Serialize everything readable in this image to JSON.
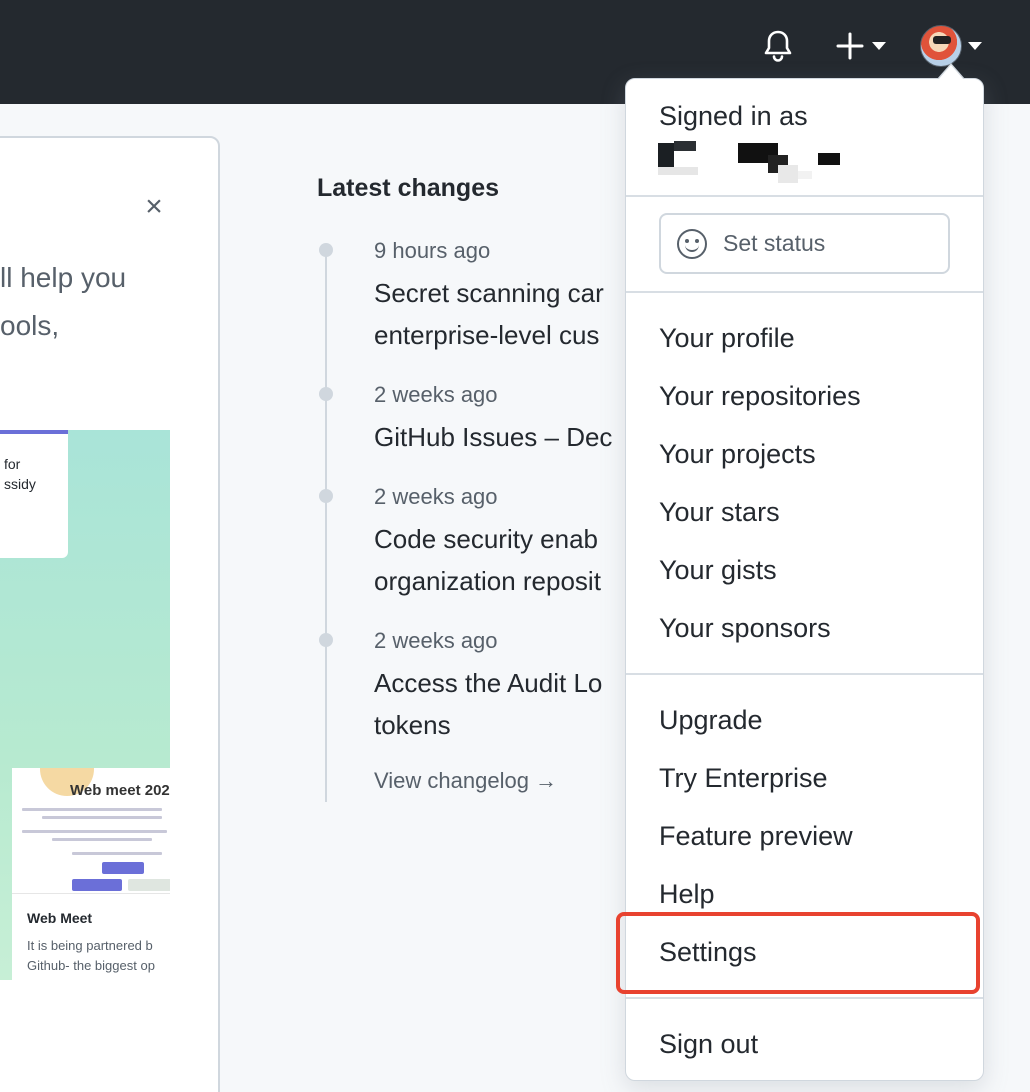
{
  "header": {
    "icons": [
      "bell-icon",
      "plus-icon",
      "caret-down-icon",
      "avatar"
    ]
  },
  "left_panel": {
    "close_symbol": "×",
    "intro_text_line1": "ll help you",
    "intro_text_line2": "ools,",
    "promo": {
      "top_card_text_line1": "for",
      "top_card_text_line2": "ssidy",
      "banner_title": "Web meet 202",
      "card_name": "Web Meet",
      "card_desc": "It is being partnered b Github- the biggest op"
    }
  },
  "changes": {
    "title": "Latest changes",
    "items": [
      {
        "time": "9 hours ago",
        "title_line1": "Secret scanning car",
        "title_line2": "enterprise-level cus"
      },
      {
        "time": "2 weeks ago",
        "title_line1": "GitHub Issues – Dec",
        "title_line2": ""
      },
      {
        "time": "2 weeks ago",
        "title_line1": "Code security enab",
        "title_line2": "organization reposit"
      },
      {
        "time": "2 weeks ago",
        "title_line1": "Access the Audit Lo",
        "title_line2": "tokens"
      }
    ],
    "view_link": "View changelog →"
  },
  "dropdown": {
    "signed_in_label": "Signed in as",
    "status_button": "Set status",
    "menu": [
      "Your profile",
      "Your repositories",
      "Your projects",
      "Your stars",
      "Your gists",
      "Your sponsors",
      "Upgrade",
      "Try Enterprise",
      "Feature preview",
      "Help",
      "Settings",
      "Sign out"
    ],
    "highlighted_item": "Settings"
  },
  "colors": {
    "header_bg": "#24292f",
    "page_bg": "#f6f8fa",
    "highlight_border": "#e8422f",
    "muted_text": "#57606a"
  }
}
